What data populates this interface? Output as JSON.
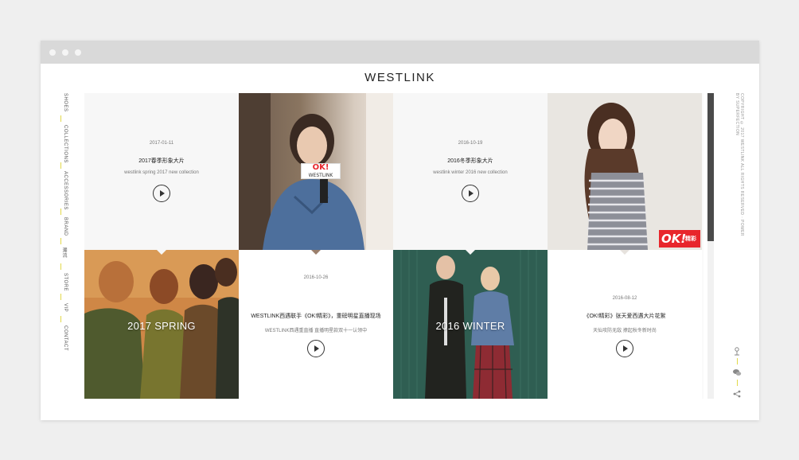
{
  "site": {
    "logo": "WESTLINK"
  },
  "sidenav": {
    "items": [
      {
        "label": "SHOES"
      },
      {
        "label": "COLLECTIONS"
      },
      {
        "label": "ACCESSORIES"
      },
      {
        "label": "BRAND"
      },
      {
        "label": "潮流"
      },
      {
        "label": "STORE"
      },
      {
        "label": "VIP"
      },
      {
        "label": "CONTACT"
      }
    ]
  },
  "tiles": {
    "t1": {
      "date": "2017-01-11",
      "title": "2017春季形象大片",
      "subtitle": "westlink spring 2017 new collection"
    },
    "t3": {
      "date": "2016-10-19",
      "title": "2016冬季形象大片",
      "subtitle": "westlink winter 2016 new collection"
    },
    "t5": {
      "label": "2017 SPRING"
    },
    "t6": {
      "date": "2016-10-26",
      "title": "WESTLINK西遇联手《OK!精彩》，重磅明星直播现场",
      "subtitle": "WESTLINK西遇重直播 直播明星款双十一认领中"
    },
    "t7": {
      "label": "2016 WINTER"
    },
    "t8": {
      "date": "2016-08-12",
      "title": "《OK!精彩》张天爱西遇大片花絮",
      "subtitle": "天仙攻防无敌 撩起秋冬新时尚"
    }
  },
  "badges": {
    "mic_badge": "OK!",
    "mic_brand": "WESTLINK",
    "magazine": "OK!",
    "magazine_cn": "精彩"
  },
  "footer": {
    "copyright": "COPYRIGHT © 2017 WESTLINK ALL RIGHTS RESERVED · POWER BY SUPERFECTION"
  },
  "colors": {
    "accent": "#e2d94a",
    "text": "#222222",
    "badge": "#e8262c"
  },
  "icons": [
    "weibo-icon",
    "wechat-icon",
    "share-icon",
    "play-icon"
  ]
}
